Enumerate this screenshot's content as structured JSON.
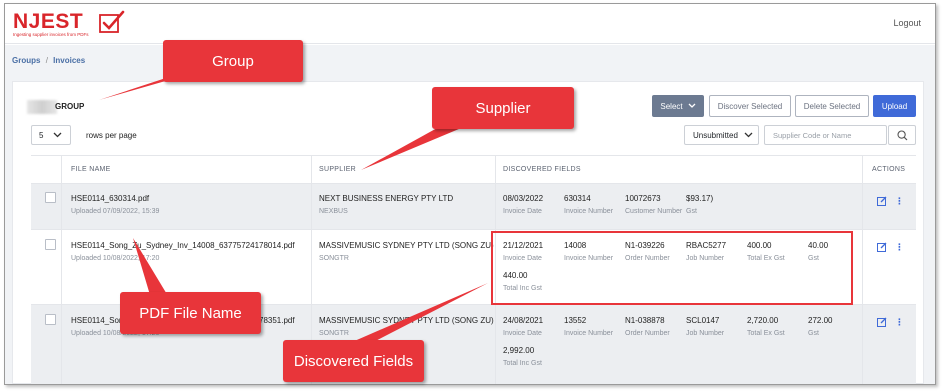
{
  "app": {
    "logo_text": "NJEST",
    "logo_tagline": "Ingesting supplier invoices from PDFs",
    "logout_label": "Logout"
  },
  "breadcrumb": {
    "root": "Groups",
    "separator": "/",
    "current": "Invoices"
  },
  "group": {
    "name": "GROUP"
  },
  "toolbar": {
    "select_label": "Select",
    "discover_label": "Discover Selected",
    "delete_label": "Delete Selected",
    "upload_label": "Upload"
  },
  "pagination": {
    "rows_value": "5",
    "rows_label": "rows per page"
  },
  "filter": {
    "status_value": "Unsubmitted",
    "search_placeholder": "Supplier Code or Name"
  },
  "table": {
    "headers": {
      "file_name": "FILE NAME",
      "supplier": "SUPPLIER",
      "discovered": "DISCOVERED FIELDS",
      "actions": "ACTIONS"
    },
    "rows": [
      {
        "file_name": "HSE0114_630314.pdf",
        "uploaded": "Uploaded 07/09/2022, 15:39",
        "supplier_name": "NEXT BUSINESS ENERGY PTY LTD",
        "supplier_code": "NEXBUS",
        "fields": [
          {
            "value": "08/03/2022",
            "label": "Invoice Date"
          },
          {
            "value": "630314",
            "label": "Invoice Number"
          },
          {
            "value": "10072673",
            "label": "Customer Number"
          },
          {
            "value": "$93.17)",
            "label": "Gst"
          }
        ]
      },
      {
        "file_name": "HSE0114_Song_Zu_Sydney_Inv_14008_63775724178014.pdf",
        "uploaded": "Uploaded 10/08/2022, 17:20",
        "supplier_name": "MASSIVEMUSIC SYDNEY PTY LTD (SONG ZU)",
        "supplier_code": "SONGTR",
        "fields": [
          {
            "value": "21/12/2021",
            "label": "Invoice Date"
          },
          {
            "value": "14008",
            "label": "Invoice Number"
          },
          {
            "value": "N1-039226",
            "label": "Order Number"
          },
          {
            "value": "RBAC5277",
            "label": "Job Number"
          },
          {
            "value": "400.00",
            "label": "Total Ex Gst"
          },
          {
            "value": "40.00",
            "label": "Gst"
          },
          {
            "value": "440.00",
            "label": "Total Inc Gst"
          }
        ]
      },
      {
        "file_name": "HSE0114_Song_Zu_Sydney_Inv_13552_63775724178351.pdf",
        "uploaded": "Uploaded 10/08/2022, 17:20",
        "supplier_name": "MASSIVEMUSIC SYDNEY PTY LTD (SONG ZU)",
        "supplier_code": "SONGTR",
        "fields": [
          {
            "value": "24/08/2021",
            "label": "Invoice Date"
          },
          {
            "value": "13552",
            "label": "Invoice Number"
          },
          {
            "value": "N1-038878",
            "label": "Order Number"
          },
          {
            "value": "SCL0147",
            "label": "Job Number"
          },
          {
            "value": "2,720.00",
            "label": "Total Ex Gst"
          },
          {
            "value": "272.00",
            "label": "Gst"
          },
          {
            "value": "2,992.00",
            "label": "Total Inc Gst"
          }
        ]
      }
    ]
  },
  "annotations": {
    "group": "Group",
    "supplier": "Supplier",
    "pdf_file_name": "PDF File  Name",
    "discovered_fields": "Discovered Fields"
  },
  "colors": {
    "accent": "#3f6ad8",
    "callout": "#e8353a",
    "brand": "#d9252a"
  }
}
